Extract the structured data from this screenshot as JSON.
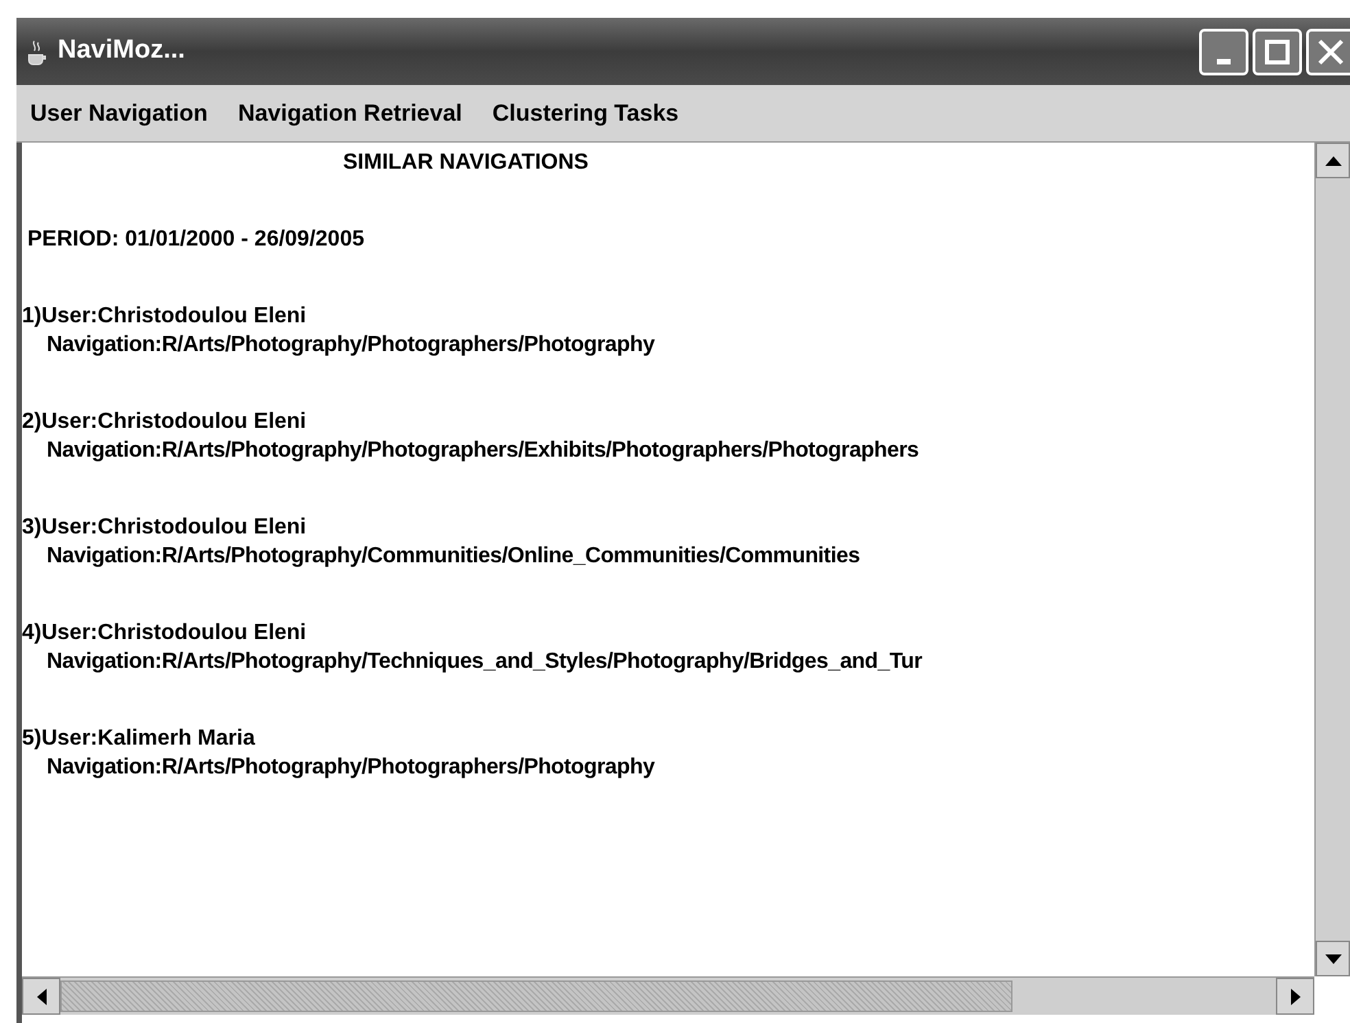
{
  "window": {
    "title": "NaviMoz..."
  },
  "menu": [
    "User Navigation",
    "Navigation Retrieval",
    "Clustering Tasks"
  ],
  "content": {
    "heading": "SIMILAR NAVIGATIONS",
    "period": "PERIOD: 01/01/2000 - 26/09/2005",
    "results": [
      {
        "user": "1)User:Christodoulou Eleni",
        "navigation": "Navigation:R/Arts/Photography/Photographers/Photography"
      },
      {
        "user": "2)User:Christodoulou Eleni",
        "navigation": "Navigation:R/Arts/Photography/Photographers/Exhibits/Photographers/Photographers"
      },
      {
        "user": "3)User:Christodoulou Eleni",
        "navigation": "Navigation:R/Arts/Photography/Communities/Online_Communities/Communities"
      },
      {
        "user": "4)User:Christodoulou Eleni",
        "navigation": "Navigation:R/Arts/Photography/Techniques_and_Styles/Photography/Bridges_and_Tur"
      },
      {
        "user": "5)User:Kalimerh Maria",
        "navigation": "Navigation:R/Arts/Photography/Photographers/Photography"
      }
    ]
  }
}
